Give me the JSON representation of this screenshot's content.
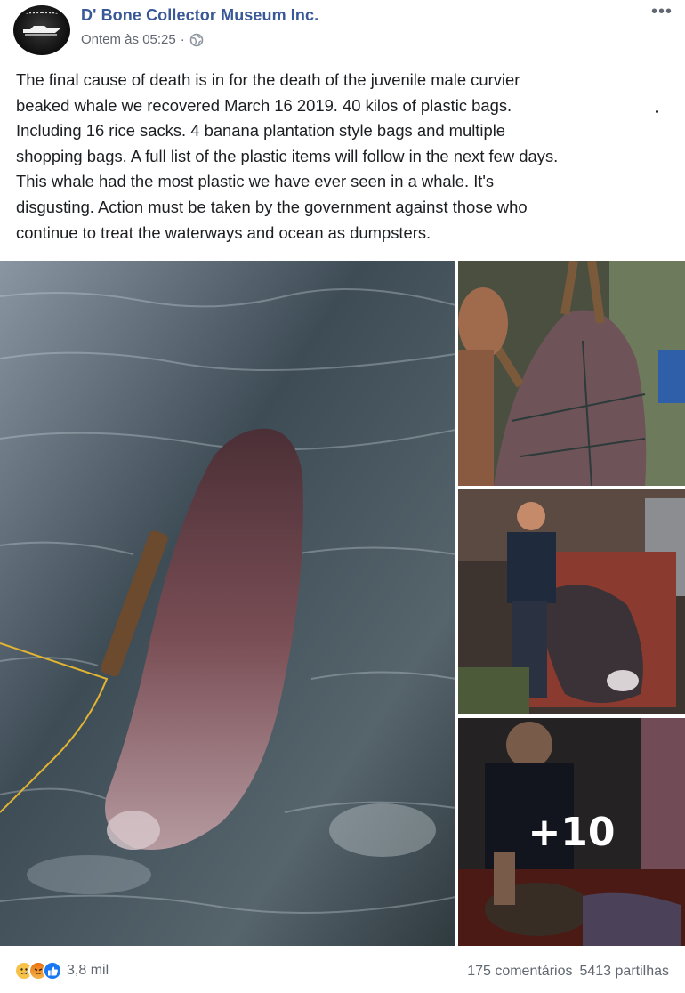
{
  "post": {
    "page_name": "D' Bone Collector Museum Inc.",
    "timestamp": "Ontem às 05:25",
    "separator": "·",
    "privacy_icon": "globe-icon",
    "more_icon": "more-options-icon",
    "text": "The final cause of death is in for the death of the juvenile male curvier\nbeaked whale we recovered March 16 2019. 40 kilos of plastic bags.\nIncluding 16 rice sacks. 4 banana plantation style bags and multiple\nshopping bags. A full list of the plastic items will follow in the next few days.\nThis whale had the most plastic we have ever seen in a whale. It's\ndisgusting. Action must be taken by the government against those who\ncontinue to treat the waterways and ocean as dumpsters."
  },
  "photos": {
    "more_count_label": "+10"
  },
  "footer": {
    "reaction_icons": [
      "sad-reaction-icon",
      "angry-reaction-icon",
      "like-reaction-icon"
    ],
    "reaction_count": "3,8 mil",
    "comments": "175 comentários",
    "shares": "5413 partilhas"
  },
  "colors": {
    "page_name": "#385898",
    "meta_text": "#616770",
    "like_blue": "#1877f2"
  }
}
